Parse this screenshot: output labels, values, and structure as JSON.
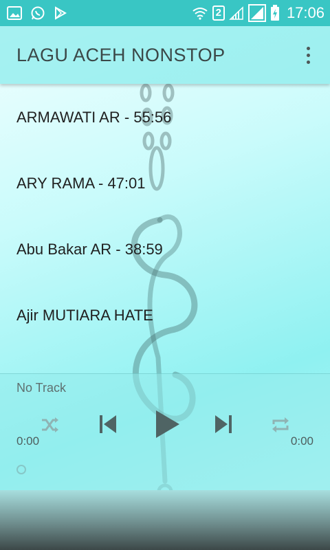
{
  "status_bar": {
    "sim_badge": "2",
    "time": "17:06",
    "icons": [
      "gallery-icon",
      "whatsapp-icon",
      "play-store-icon",
      "wifi-icon",
      "signal-icon",
      "battery-charging-icon"
    ]
  },
  "toolbar": {
    "title": "LAGU ACEH NONSTOP",
    "menu_icon": "more-vert-icon"
  },
  "songs": [
    {
      "label": "ARMAWATI AR - 55:56"
    },
    {
      "label": "ARY RAMA - 47:01"
    },
    {
      "label": "Abu Bakar AR - 38:59"
    },
    {
      "label": "Ajir MUTIARA HATE"
    }
  ],
  "player": {
    "track_name": "No Track",
    "elapsed": "0:00",
    "duration": "0:00",
    "progress": 0,
    "controls": [
      "shuffle-icon",
      "previous-icon",
      "play-icon",
      "next-icon",
      "repeat-icon"
    ]
  },
  "colors": {
    "status_bar": "#39c6c4",
    "accent": "#8cecec",
    "control_dark": "#4f6464",
    "control_faded": "#8fb3b3"
  }
}
